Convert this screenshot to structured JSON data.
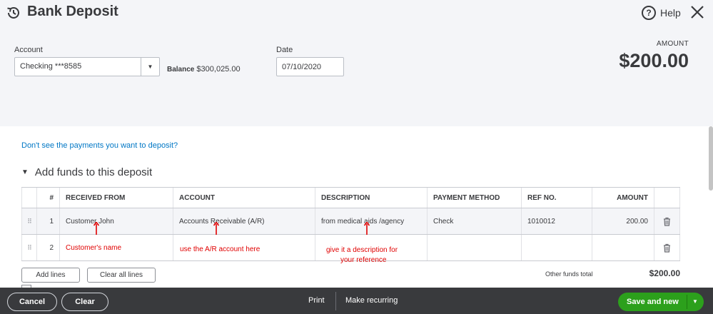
{
  "header": {
    "title": "Bank Deposit",
    "help_label": "Help",
    "help_glyph": "?"
  },
  "form": {
    "account_label": "Account",
    "account_value": "Checking ***8585",
    "balance_label": "Balance",
    "balance_value": "$300,025.00",
    "date_label": "Date",
    "date_value": "07/10/2020",
    "amount_label": "AMOUNT",
    "amount_value": "$200.00"
  },
  "main": {
    "payments_link": "Don't see the payments you want to deposit?",
    "section_title": "Add funds to this deposit",
    "columns": {
      "num": "#",
      "received_from": "RECEIVED FROM",
      "account": "ACCOUNT",
      "description": "DESCRIPTION",
      "payment_method": "PAYMENT METHOD",
      "ref_no": "REF NO.",
      "amount": "AMOUNT"
    },
    "rows": [
      {
        "num": "1",
        "received_from": "Customer John",
        "account": "Accounts Receivable (A/R)",
        "description": "from medical aids /agency",
        "payment_method": "Check",
        "ref_no": "1010012",
        "amount": "200.00"
      },
      {
        "num": "2",
        "received_from": "",
        "account": "",
        "description": "",
        "payment_method": "",
        "ref_no": "",
        "amount": ""
      }
    ],
    "annotations": {
      "customer": "Customer's name",
      "account": "use the A/R account here",
      "description_line1": "give it a description for",
      "description_line2": "your reference"
    },
    "add_lines": "Add lines",
    "clear_all_lines": "Clear all lines",
    "other_funds_label": "Other funds total",
    "other_funds_value": "$200.00"
  },
  "footer": {
    "cancel": "Cancel",
    "clear": "Clear",
    "print": "Print",
    "make_recurring": "Make recurring",
    "save_and_new": "Save and new"
  },
  "colors": {
    "accent_green": "#2ca01c",
    "link_blue": "#0077c5",
    "annotation_red": "#e00000",
    "footer_bg": "#393a3d"
  },
  "icons": [
    "history-icon",
    "help-icon",
    "close-icon",
    "caret-down-icon",
    "drag-handle-icon",
    "trash-icon"
  ]
}
